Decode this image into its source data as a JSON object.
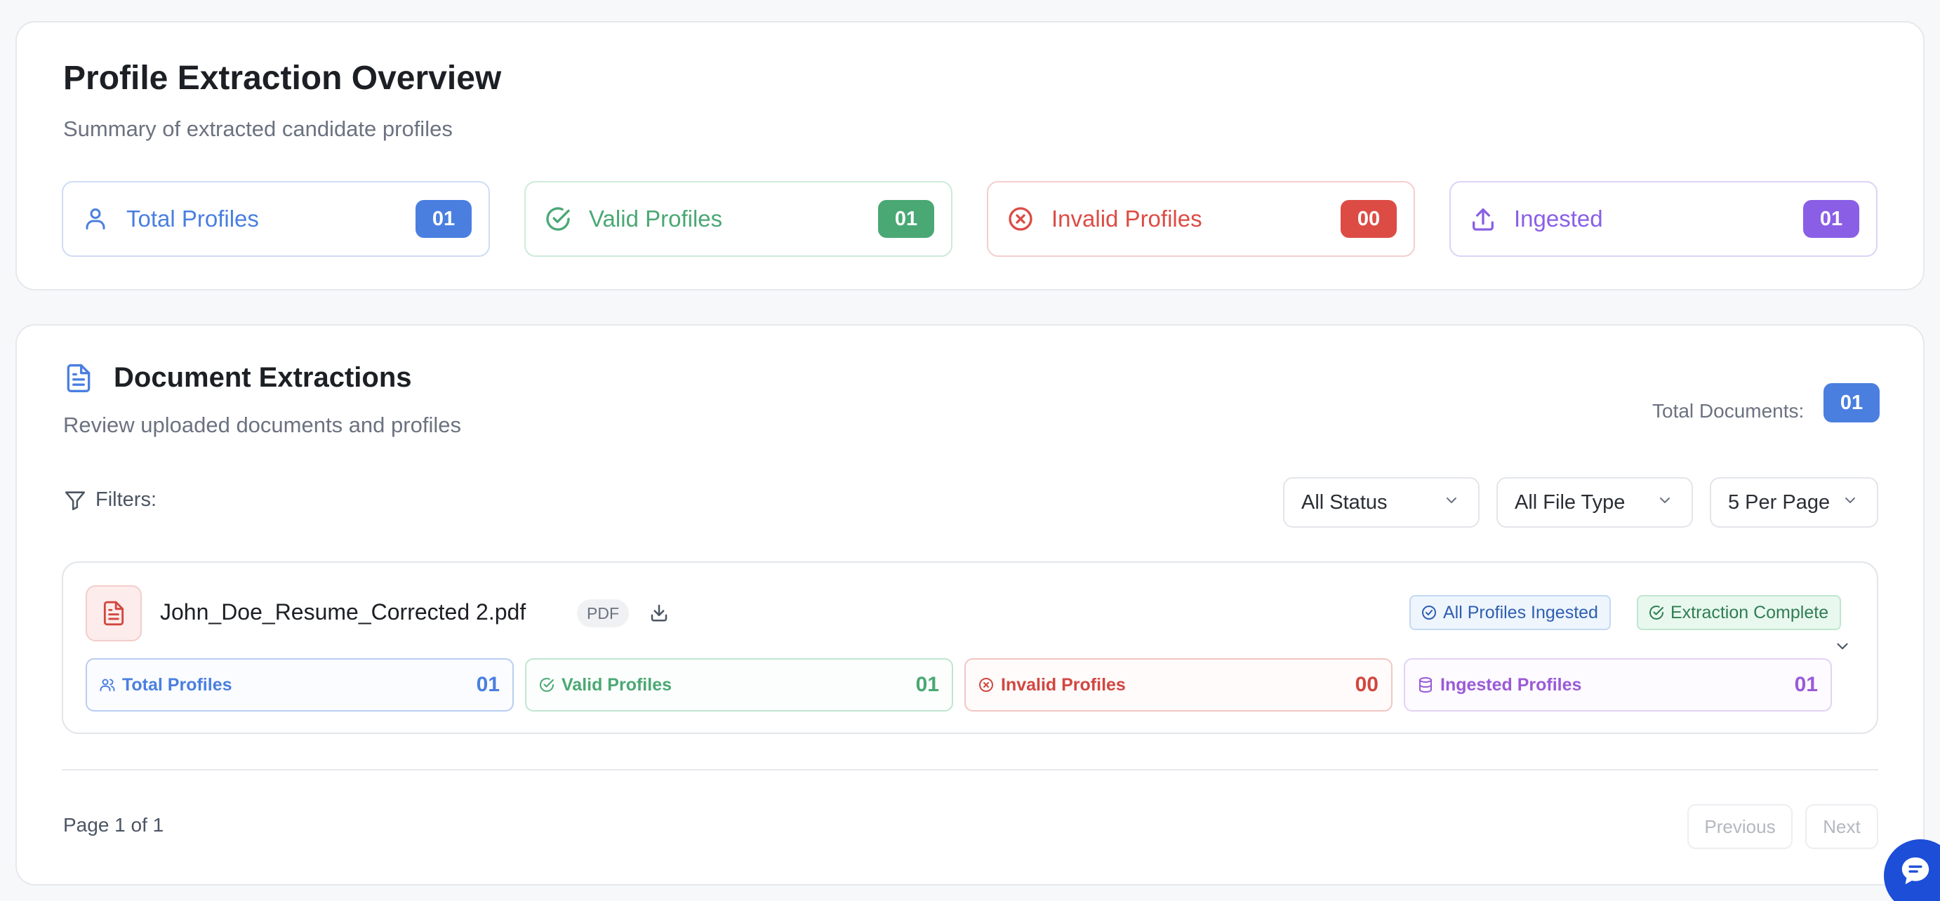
{
  "overview": {
    "title": "Profile Extraction Overview",
    "subtitle": "Summary of extracted candidate profiles",
    "stats": [
      {
        "label": "Total Profiles",
        "value": "01",
        "color": "#4a7fe0",
        "border": "#cfdcf6",
        "icon": "user-icon"
      },
      {
        "label": "Valid Profiles",
        "value": "01",
        "color": "#4aa874",
        "border": "#cdebd9",
        "icon": "check-circle-icon"
      },
      {
        "label": "Invalid Profiles",
        "value": "00",
        "color": "#dc4c45",
        "border": "#f3cfcd",
        "icon": "x-circle-icon"
      },
      {
        "label": "Ingested",
        "value": "01",
        "color": "#8a5fe6",
        "border": "#ddd3f7",
        "icon": "upload-icon"
      }
    ]
  },
  "documents": {
    "title": "Document Extractions",
    "subtitle": "Review uploaded documents and profiles",
    "total_label": "Total Documents:",
    "total_value": "01",
    "filters_label": "Filters:",
    "selects": {
      "status": "All Status",
      "file_type": "All File Type",
      "per_page": "5 Per Page"
    },
    "item": {
      "filename": "John_Doe_Resume_Corrected 2.pdf",
      "file_type": "PDF",
      "tag_ingested": "All Profiles Ingested",
      "tag_complete": "Extraction Complete",
      "stats": [
        {
          "label": "Total Profiles",
          "value": "01",
          "color": "#4a7fe0",
          "border": "#b9cdf3",
          "bg": "#fbfcff",
          "icon": "users-icon"
        },
        {
          "label": "Valid Profiles",
          "value": "01",
          "color": "#4aa874",
          "border": "#bfe6cf",
          "bg": "#fbfefc",
          "icon": "check-circle-icon"
        },
        {
          "label": "Invalid Profiles",
          "value": "00",
          "color": "#d1473f",
          "border": "#f1c6c2",
          "bg": "#fffbfb",
          "icon": "x-circle-icon"
        },
        {
          "label": "Ingested Profiles",
          "value": "01",
          "color": "#9a5ad8",
          "border": "#e2d2f4",
          "bg": "#fdfbff",
          "icon": "database-icon"
        }
      ]
    },
    "pagination": {
      "page_text": "Page 1 of 1",
      "prev": "Previous",
      "next": "Next"
    }
  }
}
